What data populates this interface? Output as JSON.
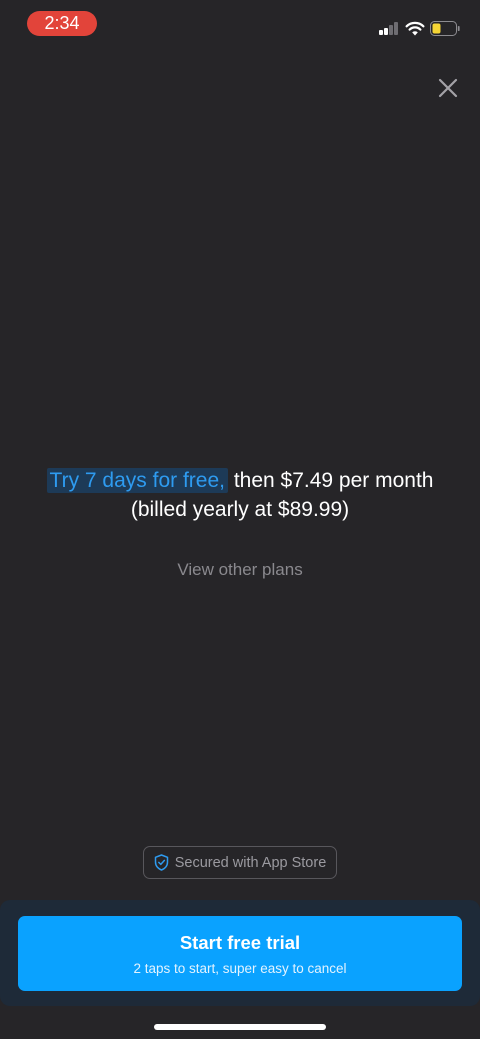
{
  "status_bar": {
    "time": "2:34",
    "signal_bars_active": 2,
    "battery_level": 0.3
  },
  "close_icon": "close-icon",
  "offer": {
    "highlight": "Try 7 days for free,",
    "text": " then $7.49 per month (billed yearly at $89.99)"
  },
  "view_plans_label": "View other plans",
  "secured": {
    "label": "Secured with App Store",
    "icon": "shield-check-icon"
  },
  "cta": {
    "title": "Start free trial",
    "subtitle": "2 taps to start, super easy to cancel"
  },
  "colors": {
    "background": "#262528",
    "accent": "#0aa2ff",
    "highlight_text": "#2e9bf0",
    "time_pill": "#e2443a",
    "battery_fill": "#f5d535"
  }
}
